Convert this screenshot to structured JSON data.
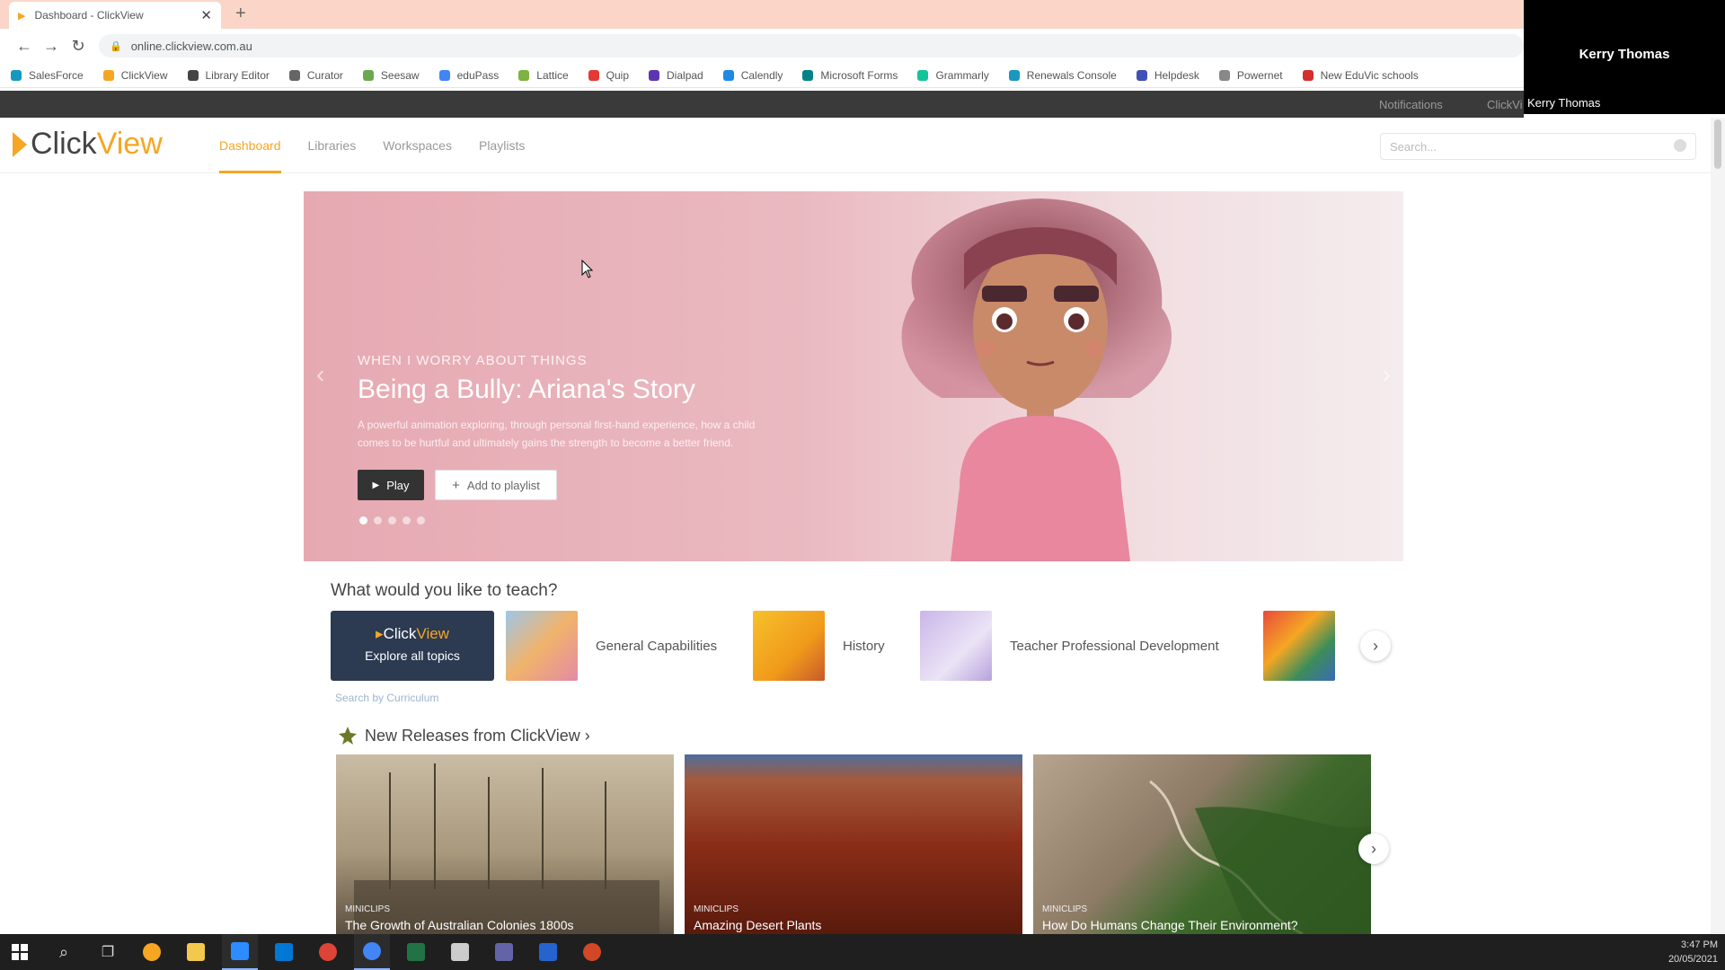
{
  "browser": {
    "tab_title": "Dashboard - ClickView",
    "url": "online.clickview.com.au",
    "bookmarks": [
      {
        "label": "SalesForce",
        "color": "#1798c1"
      },
      {
        "label": "ClickView",
        "color": "#f5a623"
      },
      {
        "label": "Library Editor",
        "color": "#444444"
      },
      {
        "label": "Curator",
        "color": "#666666"
      },
      {
        "label": "Seesaw",
        "color": "#6aa84f"
      },
      {
        "label": "eduPass",
        "color": "#4285f4"
      },
      {
        "label": "Lattice",
        "color": "#7cb342"
      },
      {
        "label": "Quip",
        "color": "#e53935"
      },
      {
        "label": "Dialpad",
        "color": "#5e35b1"
      },
      {
        "label": "Calendly",
        "color": "#1e88e5"
      },
      {
        "label": "Microsoft Forms",
        "color": "#038387"
      },
      {
        "label": "Grammarly",
        "color": "#15c39a"
      },
      {
        "label": "Renewals Console",
        "color": "#1798c1"
      },
      {
        "label": "Helpdesk",
        "color": "#3f51b5"
      },
      {
        "label": "Powernet",
        "color": "#888888"
      },
      {
        "label": "New EduVic schools",
        "color": "#d32f2f"
      }
    ]
  },
  "webcam": {
    "name": "Kerry Thomas",
    "label": "Kerry Thomas"
  },
  "site": {
    "notifications": "Notifications",
    "account": "ClickVi",
    "logo_click": "Click",
    "logo_view": "View",
    "nav": [
      "Dashboard",
      "Libraries",
      "Workspaces",
      "Playlists"
    ],
    "search_placeholder": "Search..."
  },
  "hero": {
    "kicker": "WHEN I WORRY ABOUT THINGS",
    "title": "Being a Bully: Ariana's Story",
    "description": "A powerful animation exploring, through personal first-hand experience, how a child comes to be hurtful and ultimately gains the strength to become a better friend.",
    "play_label": "Play",
    "add_label": "Add to playlist",
    "slides": 5,
    "active_slide": 0
  },
  "teach": {
    "title": "What would you like to teach?",
    "explore_logo_click": "Click",
    "explore_logo_view": "View",
    "explore_label": "Explore all topics",
    "topics": [
      "General Capabilities",
      "History",
      "Teacher Professional Development"
    ],
    "curriculum_link": "Search by Curriculum"
  },
  "releases": {
    "title": "New Releases from ClickView ›",
    "items": [
      {
        "tag": "MINICLIPS",
        "title": "The Growth of Australian Colonies 1800s"
      },
      {
        "tag": "MINICLIPS",
        "title": "Amazing Desert Plants"
      },
      {
        "tag": "MINICLIPS",
        "title": "How Do Humans Change Their Environment?"
      }
    ]
  },
  "taskbar": {
    "time": "3:47 PM",
    "date": "20/05/2021"
  }
}
